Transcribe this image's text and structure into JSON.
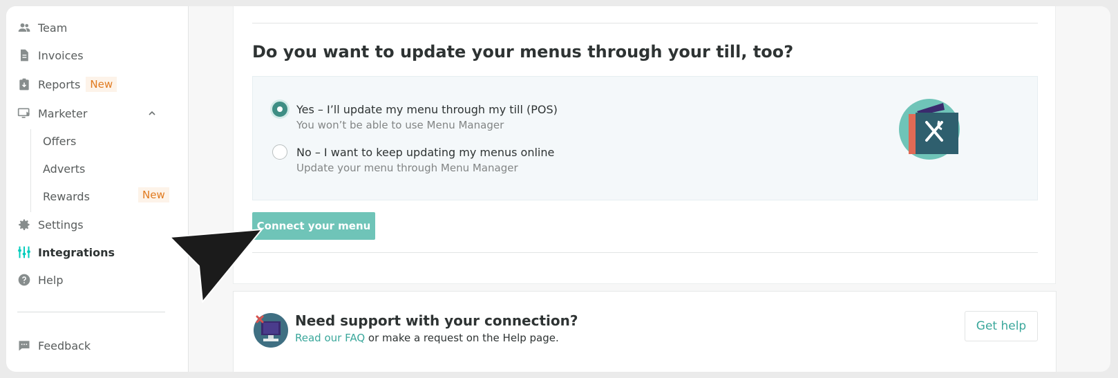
{
  "sidebar": {
    "items": [
      {
        "label": "Team",
        "icon": "team-icon"
      },
      {
        "label": "Invoices",
        "icon": "invoice-icon"
      },
      {
        "label": "Reports",
        "icon": "reports-icon",
        "badge": "New"
      },
      {
        "label": "Marketer",
        "icon": "marketer-icon"
      },
      {
        "label": "Settings",
        "icon": "gear-icon"
      },
      {
        "label": "Integrations",
        "icon": "integrations-icon",
        "active": true
      },
      {
        "label": "Help",
        "icon": "help-icon"
      },
      {
        "label": "Feedback",
        "icon": "feedback-icon"
      }
    ],
    "marketer_sub": [
      {
        "label": "Offers"
      },
      {
        "label": "Adverts"
      },
      {
        "label": "Rewards",
        "badge": "New"
      }
    ]
  },
  "main": {
    "question": "Do you want to update your menus through your till, too?",
    "options": [
      {
        "label": "Yes – I’ll update my menu through my till (POS)",
        "sub": "You won’t be able to use Menu Manager",
        "checked": true
      },
      {
        "label": "No – I want to keep updating my menus online",
        "sub": "Update your menu through Menu Manager",
        "checked": false
      }
    ],
    "connect_button": "Connect your menu"
  },
  "support": {
    "title": "Need support with your connection?",
    "link_text": "Read our FAQ",
    "rest_text": " or make a request on the Help page.",
    "button": "Get help"
  },
  "colors": {
    "accent": "#6fc4b8",
    "link": "#3aa79b",
    "badge": "#e07a1f"
  }
}
